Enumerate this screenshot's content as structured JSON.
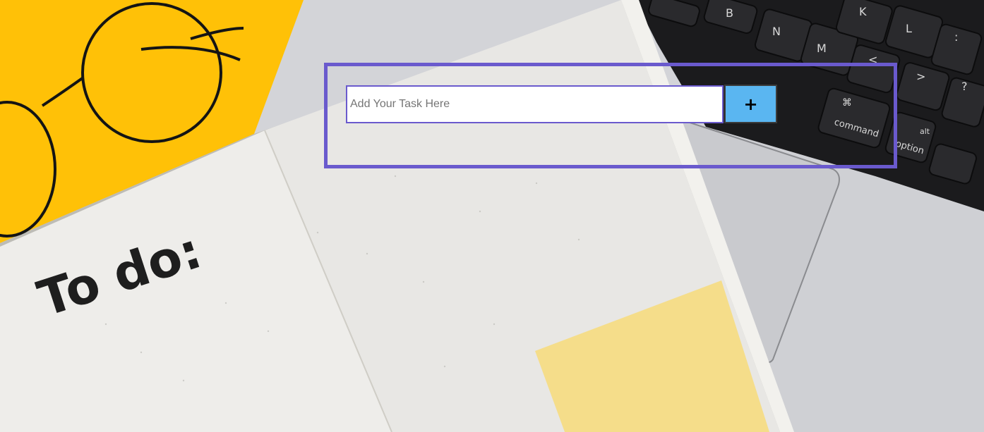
{
  "todo_form": {
    "input_placeholder": "Add Your Task Here",
    "input_value": "",
    "add_button_label": "+"
  },
  "theme": {
    "panel_border_color": "#6a5acd",
    "input_border_color": "#6a5acd",
    "add_button_color": "#5ab6f1",
    "background_yellow": "#ffc107",
    "sticky_note_color": "#f5dd8a"
  },
  "background_photo": {
    "notebook_heading": "To do:",
    "keyboard_keys": [
      "B",
      "N",
      "M",
      "K",
      "L",
      ":",
      ";",
      "<",
      ">",
      "?",
      "/",
      "⌘",
      "command",
      "alt",
      "option"
    ]
  }
}
